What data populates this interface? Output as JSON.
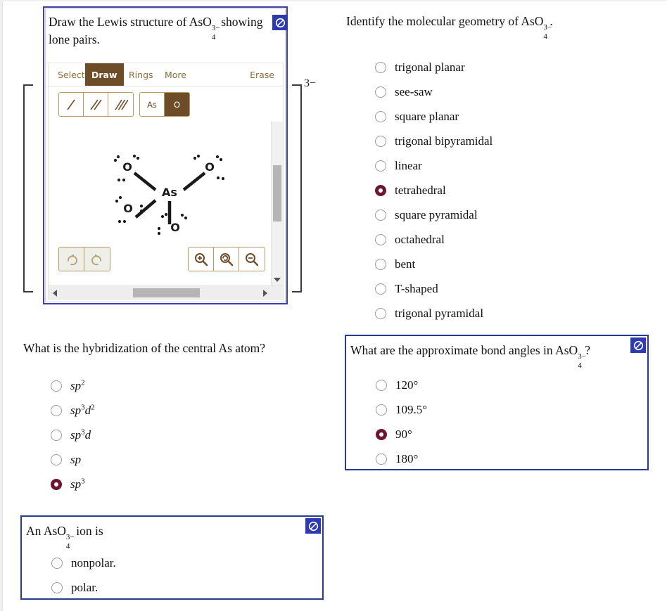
{
  "lewis_question": {
    "prompt_prefix": "Draw the Lewis structure of ",
    "formula": {
      "base": "AsO",
      "sub": "4",
      "sup": "3−"
    },
    "prompt_suffix": " showing lone pairs.",
    "flag_icon": "no-entry-icon",
    "charge_label": "3−",
    "editor": {
      "tabs": [
        {
          "label": "Select",
          "active": false
        },
        {
          "label": "Draw",
          "active": true
        },
        {
          "label": "Rings",
          "active": false
        },
        {
          "label": "More",
          "active": false
        }
      ],
      "erase_label": "Erase",
      "bond_buttons": [
        {
          "name": "single-bond-icon",
          "active": false
        },
        {
          "name": "double-bond-icon",
          "active": false
        },
        {
          "name": "triple-bond-icon",
          "active": false
        }
      ],
      "atom_buttons": [
        {
          "label": "As",
          "active": false
        },
        {
          "label": "O",
          "active": true
        }
      ],
      "history_buttons": [
        {
          "name": "redo-icon"
        },
        {
          "name": "undo-icon"
        }
      ],
      "zoom_buttons": [
        {
          "name": "zoom-in-icon"
        },
        {
          "name": "zoom-reset-icon"
        },
        {
          "name": "zoom-out-icon"
        }
      ],
      "structure": {
        "central_atom": "As",
        "terminal_atoms": [
          "O",
          "O",
          "O",
          "O"
        ],
        "bonds": "four single bonds",
        "lone_pairs_per_oxygen": 3
      }
    }
  },
  "geometry_question": {
    "title_prefix": "Identify the molecular geometry of ",
    "formula": {
      "base": "AsO",
      "sub": "4",
      "sup": "3−"
    },
    "title_suffix": ".",
    "options": [
      {
        "label": "trigonal planar",
        "selected": false
      },
      {
        "label": "see-saw",
        "selected": false
      },
      {
        "label": "square planar",
        "selected": false
      },
      {
        "label": "trigonal bipyramidal",
        "selected": false
      },
      {
        "label": "linear",
        "selected": false
      },
      {
        "label": "tetrahedral",
        "selected": true
      },
      {
        "label": "square pyramidal",
        "selected": false
      },
      {
        "label": "octahedral",
        "selected": false
      },
      {
        "label": "bent",
        "selected": false
      },
      {
        "label": "T-shaped",
        "selected": false
      },
      {
        "label": "trigonal pyramidal",
        "selected": false
      }
    ]
  },
  "hybridization_question": {
    "title": "What is the hybridization of the central As atom?",
    "options": [
      {
        "base": "sp",
        "exp": "2",
        "base2": "",
        "exp2": "",
        "selected": false
      },
      {
        "base": "sp",
        "exp": "3",
        "base2": "d",
        "exp2": "2",
        "selected": false
      },
      {
        "base": "sp",
        "exp": "3",
        "base2": "d",
        "exp2": "",
        "selected": false
      },
      {
        "base": "sp",
        "exp": "",
        "base2": "",
        "exp2": "",
        "selected": false
      },
      {
        "base": "sp",
        "exp": "3",
        "base2": "",
        "exp2": "",
        "selected": true
      }
    ]
  },
  "angles_question": {
    "title_prefix": "What are the approximate bond angles in ",
    "formula": {
      "base": "AsO",
      "sub": "4",
      "sup": "3−"
    },
    "title_suffix": "?",
    "flag_icon": "no-entry-icon",
    "options": [
      {
        "label": "120°",
        "selected": false
      },
      {
        "label": "109.5°",
        "selected": false
      },
      {
        "label": "90°",
        "selected": true
      },
      {
        "label": "180°",
        "selected": false
      }
    ]
  },
  "polarity_question": {
    "title_prefix": "An ",
    "formula": {
      "base": "AsO",
      "sub": "4",
      "sup": "3−"
    },
    "title_suffix": " ion is",
    "flag_icon": "no-entry-icon",
    "options": [
      {
        "label": "nonpolar.",
        "selected": false
      },
      {
        "label": "polar.",
        "selected": false
      }
    ]
  },
  "colors": {
    "panel_border_blue": "#2b3a8f",
    "flag_blue": "#2e3bb0",
    "selected_radio": "#6b1730",
    "editor_brown": "#6d4c27",
    "editor_border": "#b39b63"
  }
}
